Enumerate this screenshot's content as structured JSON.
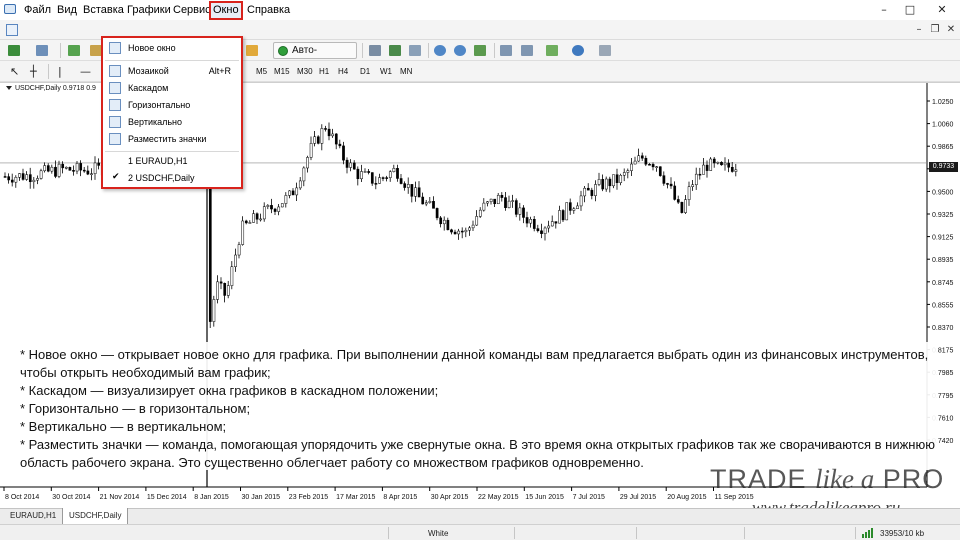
{
  "menu": {
    "items": [
      "Файл",
      "Вид",
      "Вставка",
      "Графики",
      "Сервис",
      "Окно",
      "Справка"
    ],
    "active_index": 5
  },
  "window_controls": {
    "minimize": "–",
    "maximize": "□",
    "close": "✕"
  },
  "mdi_controls": {
    "minimize": "–",
    "restore": "❐",
    "close": "✕"
  },
  "toolbar": {
    "auto_trade_label": "Авто-торговля",
    "timeframes": [
      "M5",
      "M15",
      "M30",
      "H1",
      "H4",
      "D1",
      "W1",
      "MN"
    ]
  },
  "dropdown": {
    "new_window": "Новое окно",
    "tile": "Мозаикой",
    "tile_shortcut": "Alt+R",
    "cascade": "Каскадом",
    "horizontal": "Горизонтально",
    "vertical": "Вертикально",
    "arrange_icons": "Разместить значки",
    "window_1": "1 EURAUD,H1",
    "window_2": "2 USDCHF,Daily",
    "checkmark": "✔"
  },
  "chart": {
    "symbol_label": "USDCHF,Daily",
    "ohlc": "0.9718 0.9"
  },
  "chart_data": {
    "type": "candlestick",
    "symbol": "USDCHF",
    "timeframe": "Daily",
    "current_price": "0.9733",
    "y_ticks": [
      "1.0250",
      "1.0060",
      "0.9865",
      "0.9700",
      "0.9500",
      "0.9325",
      "0.9125",
      "0.8935",
      "0.8745",
      "0.8555",
      "0.8370",
      "0.8175",
      "0.7985",
      "0.7795",
      "0.7610",
      "0.7420"
    ],
    "x_ticks": [
      "8 Oct 2014",
      "30 Oct 2014",
      "21 Nov 2014",
      "15 Dec 2014",
      "8 Jan 2015",
      "30 Jan 2015",
      "23 Feb 2015",
      "17 Mar 2015",
      "8 Apr 2015",
      "30 Apr 2015",
      "22 May 2015",
      "15 Jun 2015",
      "7 Jul 2015",
      "29 Jul 2015",
      "20 Aug 2015",
      "11 Sep 2015"
    ],
    "ylim": [
      0.73,
      1.03
    ]
  },
  "overlay": {
    "lines": [
      "* Новое окно — открывает новое окно для графика. При выполнении данной команды вам предлагается выбрать один из финансовых инструментов,",
      "чтобы открыть необходимый вам график;",
      "* Каскадом — визуализирует окна графиков в каскадном положении;",
      "* Горизонтально — в горизонтальном;",
      "* Вертикально — в вертикальном;",
      "* Разместить значки — команда, помогающая упорядочить уже свернутые окна. В это время окна открытых графиков так же сворачиваются в нижнюю",
      "область рабочего экрана. Это существенно облегчает работу со множеством графиков одновременно."
    ]
  },
  "tabs": [
    "EURAUD,H1",
    "USDCHF,Daily"
  ],
  "active_tab": 1,
  "status": {
    "profile": "White",
    "traffic": "33953/10 kb"
  },
  "watermark": {
    "brand_main": "TRADE ",
    "brand_italic": "like a",
    "brand_end": " PRO",
    "url": "www.tradelikeapro.ru"
  },
  "colors": {
    "highlight_red": "#d8231c",
    "candle": "#000000",
    "auto_trade_green": "#2f9e3a"
  }
}
